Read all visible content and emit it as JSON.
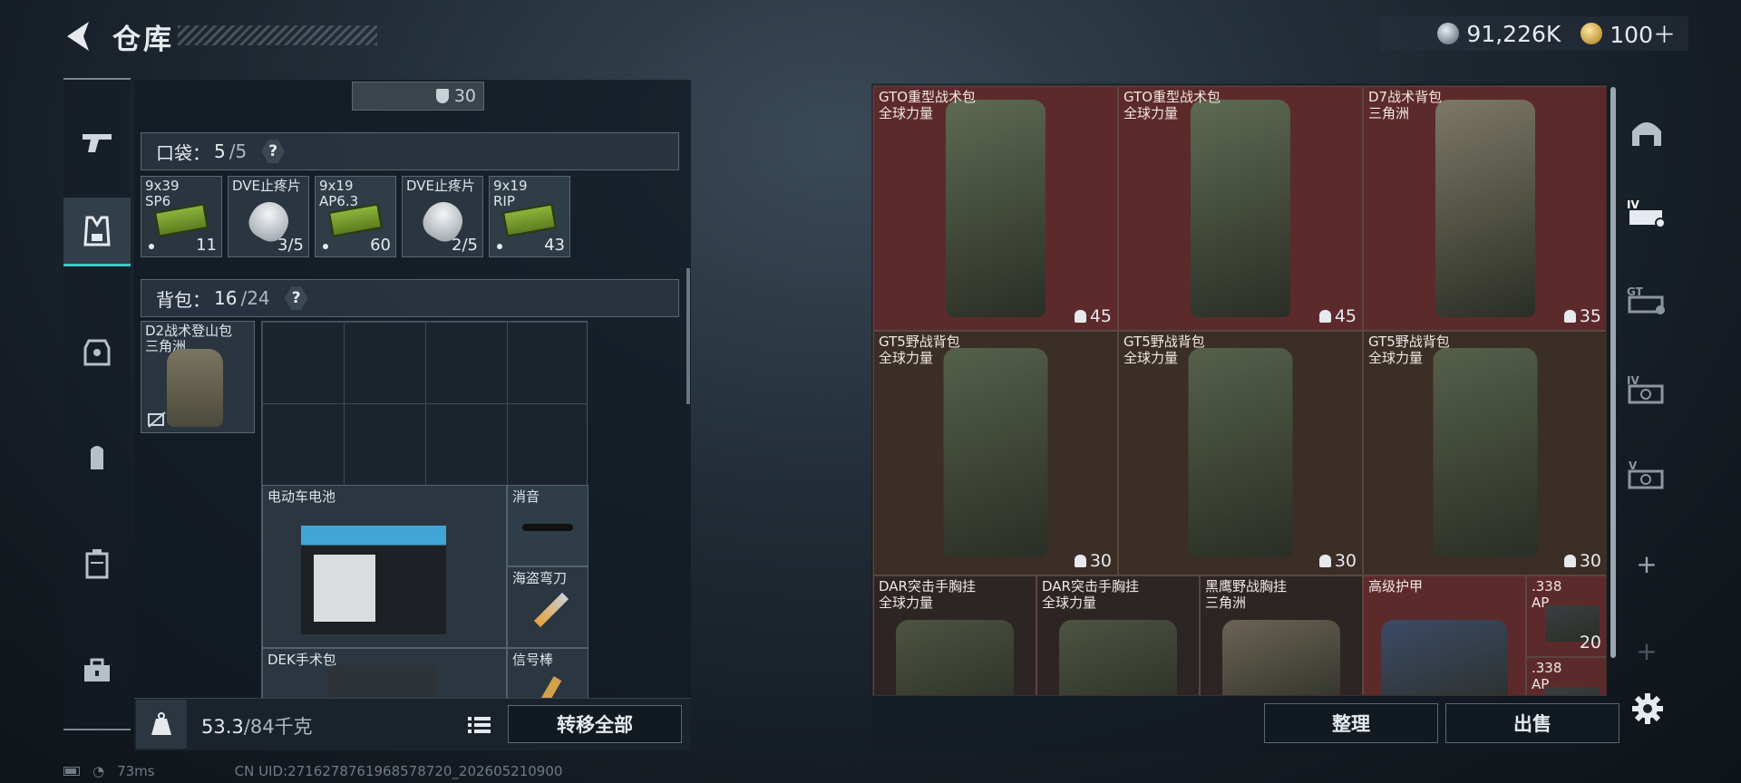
{
  "header": {
    "title": "仓库",
    "currency_silver": "91,226K",
    "currency_gold": "100＋"
  },
  "left_nav": [
    {
      "name": "nav-weapons"
    },
    {
      "name": "nav-vest"
    },
    {
      "name": "nav-armor"
    },
    {
      "name": "nav-backpack"
    },
    {
      "name": "nav-case"
    },
    {
      "name": "nav-toolbox"
    }
  ],
  "loadout": {
    "top_item_count": "30",
    "pocket": {
      "label": "口袋：",
      "used": "5",
      "capacity": "/5",
      "help": "?"
    },
    "pocket_items": [
      {
        "name": "9x39\nSP6",
        "count": "11",
        "kind": "ammo"
      },
      {
        "name": "DVE止疼片",
        "count": "3/5",
        "kind": "med"
      },
      {
        "name": "9x19\nAP6.3",
        "count": "60",
        "kind": "ammo"
      },
      {
        "name": "DVE止疼片",
        "count": "2/5",
        "kind": "med"
      },
      {
        "name": "9x19\nRIP",
        "count": "43",
        "kind": "ammo"
      }
    ],
    "backpack": {
      "label": "背包：",
      "used": "16",
      "capacity": "/24",
      "help": "?"
    },
    "backpack_equipped": {
      "name": "D2战术登山包\n三角洲"
    },
    "grid_items": [
      {
        "name": "电动车电池"
      },
      {
        "name": "消音"
      },
      {
        "name": "海盗弯刀"
      },
      {
        "name": "DEK手术包"
      },
      {
        "name": "信号棒"
      }
    ]
  },
  "weight": {
    "current": "53.3",
    "max": "/84千克"
  },
  "buttons": {
    "transfer_all": "转移全部",
    "sort": "整理",
    "sell": "出售"
  },
  "stash": [
    {
      "name": "GTO重型战术包",
      "sub": "全球力量",
      "count": "45",
      "color": "red",
      "tone": "#5e6a52"
    },
    {
      "name": "GTO重型战术包",
      "sub": "全球力量",
      "count": "45",
      "color": "red",
      "tone": "#5e6a52"
    },
    {
      "name": "D7战术背包",
      "sub": "三角洲",
      "count": "35",
      "color": "red",
      "tone": "#7d7866"
    },
    {
      "name": "GT5野战背包",
      "sub": "全球力量",
      "count": "30",
      "color": "brown",
      "tone": "#55604a"
    },
    {
      "name": "GT5野战背包",
      "sub": "全球力量",
      "count": "30",
      "color": "brown",
      "tone": "#55604a"
    },
    {
      "name": "GT5野战背包",
      "sub": "全球力量",
      "count": "30",
      "color": "brown",
      "tone": "#55604a"
    },
    {
      "name": "DAR突击手胸挂",
      "sub": "全球力量",
      "count": "",
      "color": "dark",
      "tone": "#4d5442"
    },
    {
      "name": "DAR突击手胸挂",
      "sub": "全球力量",
      "count": "",
      "color": "dark",
      "tone": "#4d5442"
    },
    {
      "name": "黑鹰野战胸挂",
      "sub": "三角洲",
      "count": "",
      "color": "dark",
      "tone": "#6b6355"
    },
    {
      "name": "高级护甲",
      "sub": "",
      "count": "",
      "color": "red",
      "tone": "#3c4a66"
    },
    {
      "name": ".338\nAP",
      "sub": "",
      "count": "20",
      "color": "red",
      "tone": "#3a3f42"
    },
    {
      "name": ".338\nAP",
      "sub": "",
      "count": "",
      "color": "red",
      "tone": "#3a3f42"
    }
  ],
  "right_nav": [
    {
      "label": ""
    },
    {
      "label": "IV"
    },
    {
      "label": "GT"
    },
    {
      "label": "IV"
    },
    {
      "label": "V"
    }
  ],
  "status": {
    "ping": "73ms",
    "uid": "CN UID:2716278761968578720_202605210900"
  }
}
